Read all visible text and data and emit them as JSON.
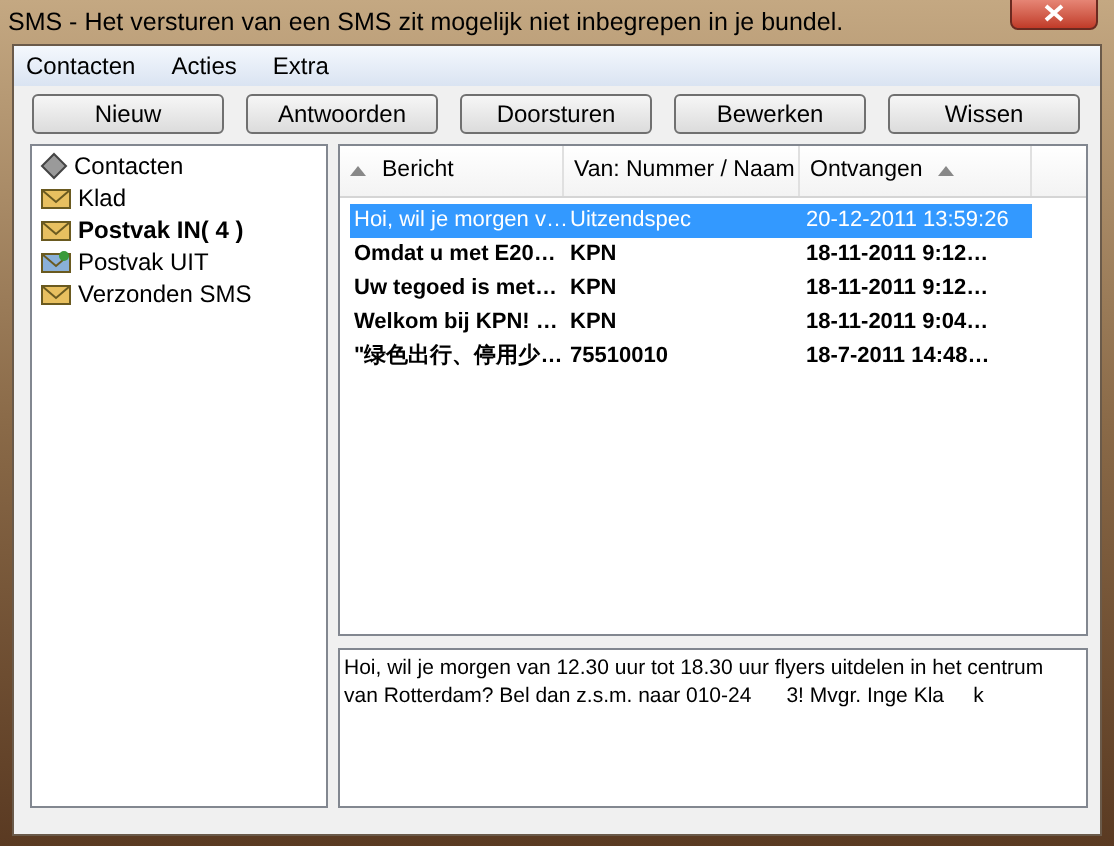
{
  "window": {
    "title": "SMS - Het versturen van een SMS zit mogelijk niet inbegrepen in je bundel."
  },
  "menu": [
    "Contacten",
    "Acties",
    "Extra"
  ],
  "toolbar": [
    "Nieuw",
    "Antwoorden",
    "Doorsturen",
    "Bewerken",
    "Wissen"
  ],
  "folders": [
    {
      "label": "Contacten",
      "kind": "contacts",
      "unread": false
    },
    {
      "label": "Klad",
      "kind": "drafts",
      "unread": false
    },
    {
      "label": "Postvak IN( 4 )",
      "kind": "inbox",
      "unread": true
    },
    {
      "label": "Postvak UIT",
      "kind": "outbox",
      "unread": false
    },
    {
      "label": "Verzonden SMS",
      "kind": "sent",
      "unread": false
    }
  ],
  "table": {
    "columns": [
      {
        "label": "Bericht",
        "sorted": true
      },
      {
        "label": "Van: Nummer / Naam",
        "sorted": false
      },
      {
        "label": "Ontvangen",
        "sorted": true
      }
    ],
    "rows": [
      {
        "cells": [
          "Hoi, wil je morgen v…",
          "Uitzendspec",
          "20-12-2011 13:59:26"
        ],
        "selected": true,
        "unread": false
      },
      {
        "cells": [
          "Omdat u met E20…",
          "KPN",
          "18-11-2011 9:12…"
        ],
        "selected": false,
        "unread": true
      },
      {
        "cells": [
          "Uw tegoed is met…",
          "KPN",
          "18-11-2011 9:12…"
        ],
        "selected": false,
        "unread": true
      },
      {
        "cells": [
          "Welkom bij KPN! …",
          "KPN",
          "18-11-2011 9:04…"
        ],
        "selected": false,
        "unread": true
      },
      {
        "cells": [
          "\"绿色出行、停用少…",
          "75510010",
          "18-7-2011 14:48…"
        ],
        "selected": false,
        "unread": true
      }
    ]
  },
  "preview": {
    "text": "Hoi, wil je morgen van 12.30 uur tot 18.30 uur flyers uitdelen in het centrum van Rotterdam? Bel dan z.s.m. naar 010-24      3! Mvgr. Inge Kla     k"
  }
}
